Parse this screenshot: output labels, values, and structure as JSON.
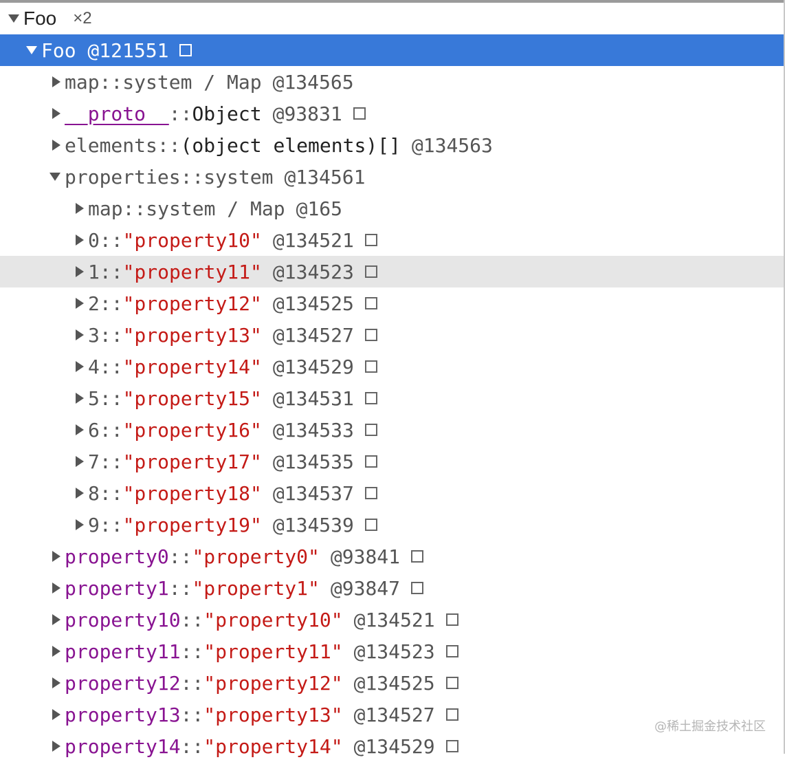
{
  "header": {
    "label": "Foo",
    "count": "×2"
  },
  "selected": {
    "label": "Foo @121551"
  },
  "items": [
    {
      "name": "map",
      "sep": " :: ",
      "type": "system / Map",
      "addr": "@134565",
      "box": false
    },
    {
      "name": "__proto__",
      "sep": " :: ",
      "type": "Object",
      "addr": "@93831",
      "box": true
    },
    {
      "name": "elements",
      "sep": " :: ",
      "type": "(object elements)[]",
      "addr": "@134563",
      "box": false
    },
    {
      "name": "properties",
      "sep": " :: ",
      "type": "system",
      "addr": "@134561",
      "box": false
    }
  ],
  "props": {
    "map": {
      "name": "map",
      "sep": " :: ",
      "type": "system / Map",
      "addr": "@165"
    },
    "entries": [
      {
        "idx": "0",
        "sep": " :: ",
        "str": "\"property10\"",
        "addr": "@134521"
      },
      {
        "idx": "1",
        "sep": " :: ",
        "str": "\"property11\"",
        "addr": "@134523"
      },
      {
        "idx": "2",
        "sep": " :: ",
        "str": "\"property12\"",
        "addr": "@134525"
      },
      {
        "idx": "3",
        "sep": " :: ",
        "str": "\"property13\"",
        "addr": "@134527"
      },
      {
        "idx": "4",
        "sep": " :: ",
        "str": "\"property14\"",
        "addr": "@134529"
      },
      {
        "idx": "5",
        "sep": " :: ",
        "str": "\"property15\"",
        "addr": "@134531"
      },
      {
        "idx": "6",
        "sep": " :: ",
        "str": "\"property16\"",
        "addr": "@134533"
      },
      {
        "idx": "7",
        "sep": " :: ",
        "str": "\"property17\"",
        "addr": "@134535"
      },
      {
        "idx": "8",
        "sep": " :: ",
        "str": "\"property18\"",
        "addr": "@134537"
      },
      {
        "idx": "9",
        "sep": " :: ",
        "str": "\"property19\"",
        "addr": "@134539"
      }
    ]
  },
  "named": [
    {
      "name": "property0",
      "sep": " :: ",
      "str": "\"property0\"",
      "addr": "@93841"
    },
    {
      "name": "property1",
      "sep": " :: ",
      "str": "\"property1\"",
      "addr": "@93847"
    },
    {
      "name": "property10",
      "sep": " :: ",
      "str": "\"property10\"",
      "addr": "@134521"
    },
    {
      "name": "property11",
      "sep": " :: ",
      "str": "\"property11\"",
      "addr": "@134523"
    },
    {
      "name": "property12",
      "sep": " :: ",
      "str": "\"property12\"",
      "addr": "@134525"
    },
    {
      "name": "property13",
      "sep": " :: ",
      "str": "\"property13\"",
      "addr": "@134527"
    },
    {
      "name": "property14",
      "sep": " :: ",
      "str": "\"property14\"",
      "addr": "@134529"
    }
  ],
  "watermark": "@稀土掘金技术社区",
  "colors": {
    "selection": "#3879d9",
    "hover": "#e6e6e6",
    "string": "#c41a16",
    "property_name": "#881391"
  }
}
